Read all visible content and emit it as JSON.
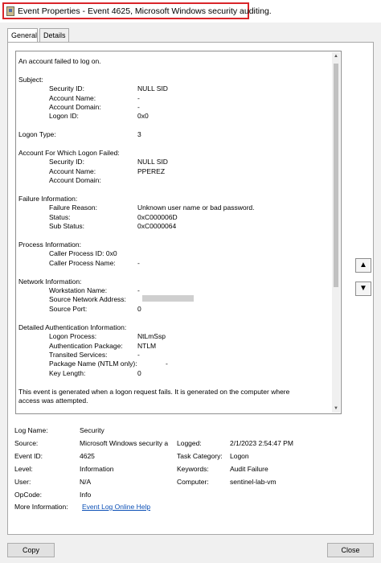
{
  "window": {
    "title": "Event Properties - Event 4625, Microsoft Windows security auditing."
  },
  "tabs": [
    {
      "label": "General",
      "active": true
    },
    {
      "label": "Details",
      "active": false
    }
  ],
  "description": {
    "summary": "An account failed to log on.",
    "subject_header": "Subject:",
    "subject": [
      {
        "label": "Security ID:",
        "value": "NULL SID"
      },
      {
        "label": "Account Name:",
        "value": "-"
      },
      {
        "label": "Account Domain:",
        "value": "-"
      },
      {
        "label": "Logon ID:",
        "value": "0x0"
      }
    ],
    "logon_type": {
      "label": "Logon Type:",
      "value": "3"
    },
    "failed_header": "Account For Which Logon Failed:",
    "failed": [
      {
        "label": "Security ID:",
        "value": "NULL SID"
      },
      {
        "label": "Account Name:",
        "value": "PPEREZ"
      },
      {
        "label": "Account Domain:",
        "value": ""
      }
    ],
    "failure_header": "Failure Information:",
    "failure": [
      {
        "label": "Failure Reason:",
        "value": "Unknown user name or bad password."
      },
      {
        "label": "Status:",
        "value": "0xC000006D"
      },
      {
        "label": "Sub Status:",
        "value": "0xC0000064"
      }
    ],
    "process_header": "Process Information:",
    "process": {
      "caller_id_line": "Caller Process ID:  0x0",
      "caller_name": {
        "label": "Caller Process Name:",
        "value": "-"
      }
    },
    "network_header": "Network Information:",
    "network": [
      {
        "label": "Workstation Name:",
        "value": "-"
      },
      {
        "label": "Source Network Address:",
        "value": ""
      },
      {
        "label": "Source Port:",
        "value": "0"
      }
    ],
    "auth_header": "Detailed Authentication Information:",
    "auth": [
      {
        "label": "Logon Process:",
        "value": "NtLmSsp"
      },
      {
        "label": "Authentication Package:",
        "value": "NTLM"
      },
      {
        "label": "Transited Services:",
        "value": "-"
      },
      {
        "label": "Package Name (NTLM only):",
        "value": "-"
      },
      {
        "label": "Key Length:",
        "value": "0"
      }
    ],
    "footer_line1": "This event is generated when a logon request fails. It is generated on the computer where",
    "footer_line2": "access was attempted."
  },
  "properties": {
    "log_name": {
      "label": "Log Name:",
      "value": "Security"
    },
    "source": {
      "label": "Source:",
      "value": "Microsoft Windows security a"
    },
    "logged": {
      "label": "Logged:",
      "value": "2/1/2023 2:54:47 PM"
    },
    "event_id": {
      "label": "Event ID:",
      "value": "4625"
    },
    "task_category": {
      "label": "Task Category:",
      "value": "Logon"
    },
    "level": {
      "label": "Level:",
      "value": "Information"
    },
    "keywords": {
      "label": "Keywords:",
      "value": "Audit Failure"
    },
    "user": {
      "label": "User:",
      "value": "N/A"
    },
    "computer": {
      "label": "Computer:",
      "value": "sentinel-lab-vm"
    },
    "opcode": {
      "label": "OpCode:",
      "value": "Info"
    },
    "more_info": {
      "label": "More Information:",
      "value": "Event Log Online Help"
    }
  },
  "buttons": {
    "copy": "Copy",
    "close": "Close"
  },
  "icons": {
    "app": "event-viewer-icon",
    "up": "up-arrow-icon",
    "down": "down-arrow-icon"
  },
  "colors": {
    "highlight": "#d9252a",
    "link": "#0b4fb6"
  }
}
